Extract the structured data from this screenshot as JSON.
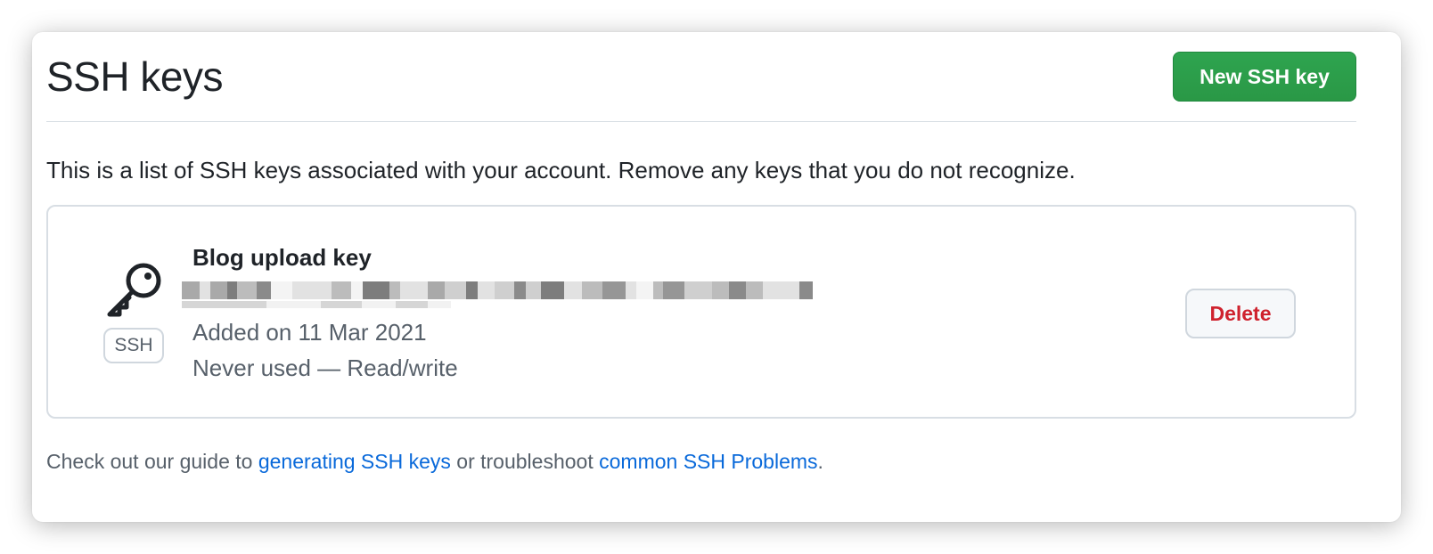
{
  "header": {
    "title": "SSH keys",
    "new_key_label": "New SSH key"
  },
  "intro": "This is a list of SSH keys associated with your account. Remove any keys that you do not recognize.",
  "keys": [
    {
      "icon": "key-icon",
      "type_badge": "SSH",
      "title": "Blog upload key",
      "fingerprint_redacted": true,
      "added": "Added on 11 Mar 2021",
      "usage": "Never used — Read/write",
      "delete_label": "Delete"
    }
  ],
  "footer": {
    "prefix": "Check out our guide to ",
    "link1": "generating SSH keys",
    "middle": " or troubleshoot ",
    "link2": "common SSH Problems",
    "suffix": "."
  },
  "colors": {
    "primary_button": "#2da44e",
    "danger_text": "#cf222e",
    "link": "#0969da",
    "border": "#d8dee4"
  }
}
